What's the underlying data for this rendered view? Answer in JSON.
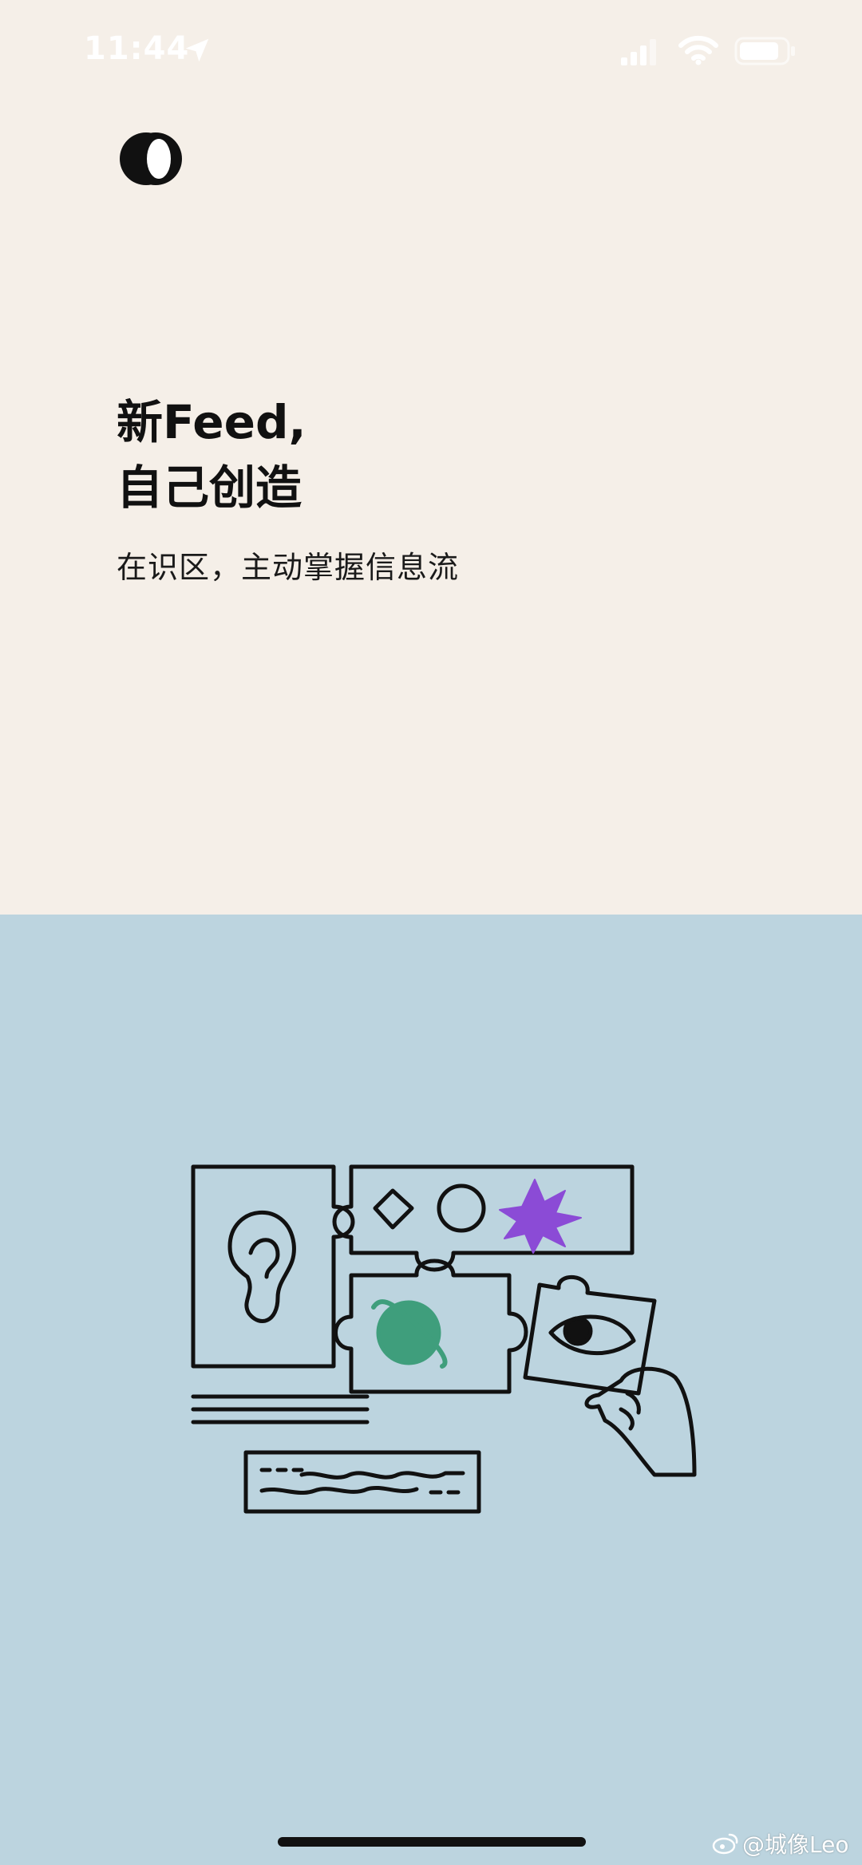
{
  "status_bar": {
    "time": "11:44"
  },
  "onboarding": {
    "headline_line1": "新Feed,",
    "headline_line2": "自己创造",
    "subtitle": "在识区，主动掌握信息流"
  },
  "watermark": {
    "text": "@城像Leo"
  },
  "colors": {
    "top_background": "#f5efe8",
    "bottom_background": "#bcd4df",
    "text": "#111111",
    "accent_purple": "#8b4bd6",
    "accent_green": "#3f9e7c"
  },
  "icons": {
    "logo": "app-logo-icon",
    "location": "location-arrow-icon",
    "signal": "cellular-signal-icon",
    "wifi": "wifi-icon",
    "battery": "battery-icon"
  }
}
